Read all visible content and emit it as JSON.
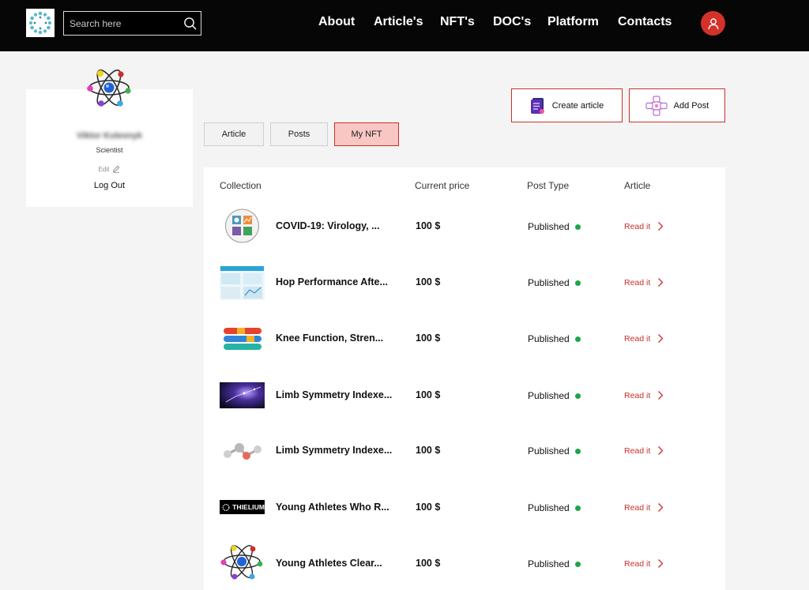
{
  "header": {
    "search_placeholder": "Search here",
    "nav": [
      "About",
      "Article's",
      "NFT's",
      "DOC's",
      "Platform",
      "Contacts"
    ]
  },
  "profile": {
    "name": "Viktor Kolesnyk",
    "role": "Scientist",
    "edit_label": "Edit",
    "logout_label": "Log Out"
  },
  "actions": {
    "create_article": "Create article",
    "add_post": "Add Post"
  },
  "tabs": [
    "Article",
    "Posts",
    "My NFT"
  ],
  "active_tab": "My NFT",
  "table": {
    "columns": [
      "Collection",
      "Current price",
      "Post Type",
      "Article"
    ],
    "rows": [
      {
        "name": "COVID-19: Virology, ...",
        "price": "100 $",
        "type": "Published",
        "link": "Read it"
      },
      {
        "name": "Hop Performance Afte...",
        "price": "100 $",
        "type": "Published",
        "link": "Read it"
      },
      {
        "name": "Knee Function, Stren...",
        "price": "100 $",
        "type": "Published",
        "link": "Read it"
      },
      {
        "name": "Limb Symmetry Indexe...",
        "price": "100 $",
        "type": "Published",
        "link": "Read it"
      },
      {
        "name": "Limb Symmetry Indexe...",
        "price": "100 $",
        "type": "Published",
        "link": "Read it"
      },
      {
        "name": "Young Athletes Who R...",
        "price": "100 $",
        "type": "Published",
        "link": "Read it",
        "thumb_text": "THIELIUM"
      },
      {
        "name": "Young Athletes Clear...",
        "price": "100 $",
        "type": "Published",
        "link": "Read it"
      }
    ]
  },
  "colors": {
    "header_bg": "#060606",
    "accent": "#c8312a",
    "active_tab_bg": "#f8c6c3",
    "status_dot": "#1ea44a"
  },
  "icons": [
    "logo-icon",
    "search-icon",
    "user-icon",
    "atom-icon",
    "edit-pencil-icon",
    "document-icon",
    "network-icon",
    "chevron-right-icon"
  ]
}
